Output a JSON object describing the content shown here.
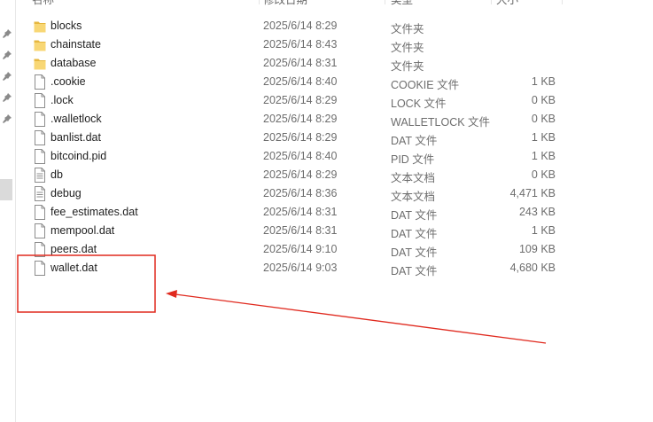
{
  "header": {
    "name": "名称",
    "modified": "修改日期",
    "type": "类型",
    "size": "大小"
  },
  "files": [
    {
      "icon": "folder-icon",
      "name": "blocks",
      "date": "2025/6/14 8:29",
      "type": "文件夹",
      "size": ""
    },
    {
      "icon": "folder-icon",
      "name": "chainstate",
      "date": "2025/6/14 8:43",
      "type": "文件夹",
      "size": ""
    },
    {
      "icon": "folder-icon",
      "name": "database",
      "date": "2025/6/14 8:31",
      "type": "文件夹",
      "size": ""
    },
    {
      "icon": "file-icon",
      "name": ".cookie",
      "date": "2025/6/14 8:40",
      "type": "COOKIE 文件",
      "size": "1 KB"
    },
    {
      "icon": "file-icon",
      "name": ".lock",
      "date": "2025/6/14 8:29",
      "type": "LOCK 文件",
      "size": "0 KB"
    },
    {
      "icon": "file-icon",
      "name": ".walletlock",
      "date": "2025/6/14 8:29",
      "type": "WALLETLOCK 文件",
      "size": "0 KB"
    },
    {
      "icon": "file-icon",
      "name": "banlist.dat",
      "date": "2025/6/14 8:29",
      "type": "DAT 文件",
      "size": "1 KB"
    },
    {
      "icon": "file-icon",
      "name": "bitcoind.pid",
      "date": "2025/6/14 8:40",
      "type": "PID 文件",
      "size": "1 KB"
    },
    {
      "icon": "text-file-icon",
      "name": "db",
      "date": "2025/6/14 8:29",
      "type": "文本文档",
      "size": "0 KB"
    },
    {
      "icon": "text-file-icon",
      "name": "debug",
      "date": "2025/6/14 8:36",
      "type": "文本文档",
      "size": "4,471 KB"
    },
    {
      "icon": "file-icon",
      "name": "fee_estimates.dat",
      "date": "2025/6/14 8:31",
      "type": "DAT 文件",
      "size": "243 KB"
    },
    {
      "icon": "file-icon",
      "name": "mempool.dat",
      "date": "2025/6/14 8:31",
      "type": "DAT 文件",
      "size": "1 KB"
    },
    {
      "icon": "file-icon",
      "name": "peers.dat",
      "date": "2025/6/14 9:10",
      "type": "DAT 文件",
      "size": "109 KB"
    },
    {
      "icon": "file-icon",
      "name": "wallet.dat",
      "date": "2025/6/14 9:03",
      "type": "DAT 文件",
      "size": "4,680 KB"
    }
  ],
  "colors": {
    "folder": "#f8d775",
    "folder_dark": "#e6b73f",
    "annotation": "#e02a1f"
  }
}
